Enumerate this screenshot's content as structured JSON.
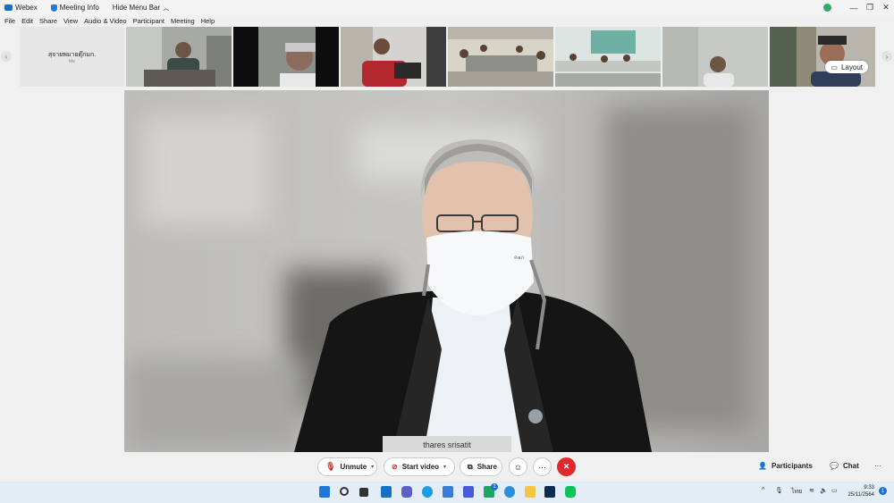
{
  "titlebar": {
    "app_name": "Webex",
    "meeting_info": "Meeting Info",
    "hide_menu_bar": "Hide Menu Bar",
    "minimize": "—",
    "restore": "❐",
    "close": "✕"
  },
  "menu": [
    "File",
    "Edit",
    "Share",
    "View",
    "Audio & Video",
    "Participant",
    "Meeting",
    "Help"
  ],
  "strip": {
    "self_name": "สุจายพมายดุ๊กมก.",
    "self_sub": "Me",
    "layout_label": "Layout",
    "prev": "‹",
    "next": "›"
  },
  "stage": {
    "speaker_name": "thares srisatit",
    "mask_print": "ค๑ก"
  },
  "controls": {
    "unmute": "Unmute",
    "start_video": "Start video",
    "share": "Share",
    "more": "···",
    "end": "✕",
    "participants": "Participants",
    "chat": "Chat",
    "overflow": "···"
  },
  "taskbar": {
    "tray_up": "^",
    "lang": "ไทย",
    "time": "9:33",
    "date": "25/11/2564",
    "notification_count": "1",
    "teams_badge": "1"
  }
}
